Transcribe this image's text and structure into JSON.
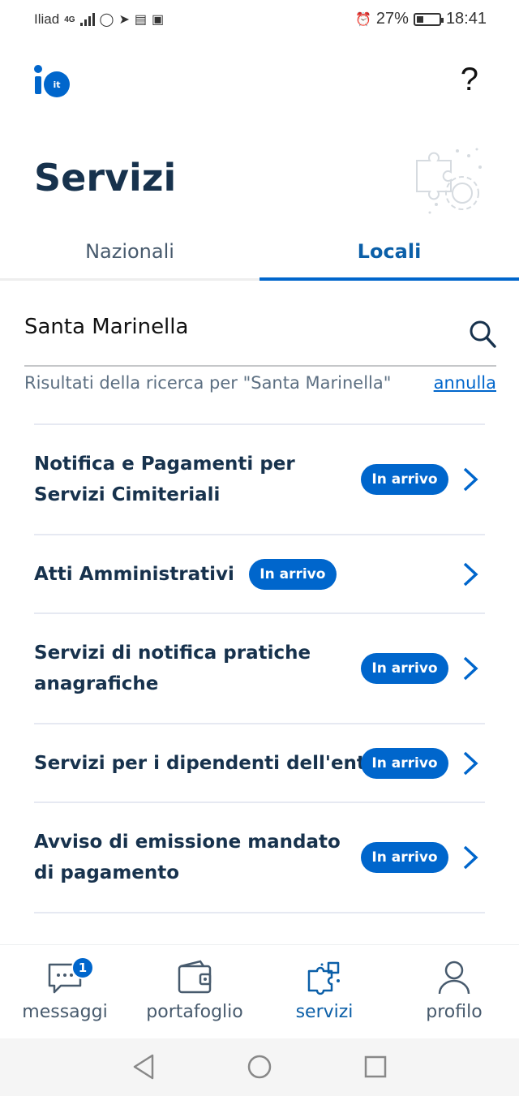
{
  "status_bar": {
    "carrier": "Iliad",
    "network": "4G",
    "battery_percent": "27%",
    "time": "18:41"
  },
  "header": {
    "logo_text": "it",
    "help_label": "?"
  },
  "page": {
    "title": "Servizi"
  },
  "tabs": [
    {
      "label": "Nazionali",
      "active": false
    },
    {
      "label": "Locali",
      "active": true
    }
  ],
  "search": {
    "value": "Santa Marinella",
    "results_text": "Risultati della ricerca per \"Santa Marinella\"",
    "cancel_label": "annulla"
  },
  "services": [
    {
      "title": "Notifica e Pagamenti per Servizi Cimiteriali",
      "badge": "In arrivo"
    },
    {
      "title": "Atti Amministrativi",
      "badge": "In arrivo"
    },
    {
      "title": "Servizi di notifica pratiche anagrafiche",
      "badge": "In arrivo"
    },
    {
      "title": "Servizi per i dipendenti dell'ente",
      "badge": "In arrivo"
    },
    {
      "title": "Avviso di emissione mandato di pagamento",
      "badge": "In arrivo"
    }
  ],
  "bottom_nav": [
    {
      "label": "messaggi",
      "icon": "message-icon",
      "badge": "1"
    },
    {
      "label": "portafoglio",
      "icon": "wallet-icon"
    },
    {
      "label": "servizi",
      "icon": "puzzle-icon",
      "active": true
    },
    {
      "label": "profilo",
      "icon": "user-icon"
    }
  ],
  "colors": {
    "primary": "#0066cc",
    "text_dark": "#17324d",
    "text_muted": "#5c6f82"
  }
}
